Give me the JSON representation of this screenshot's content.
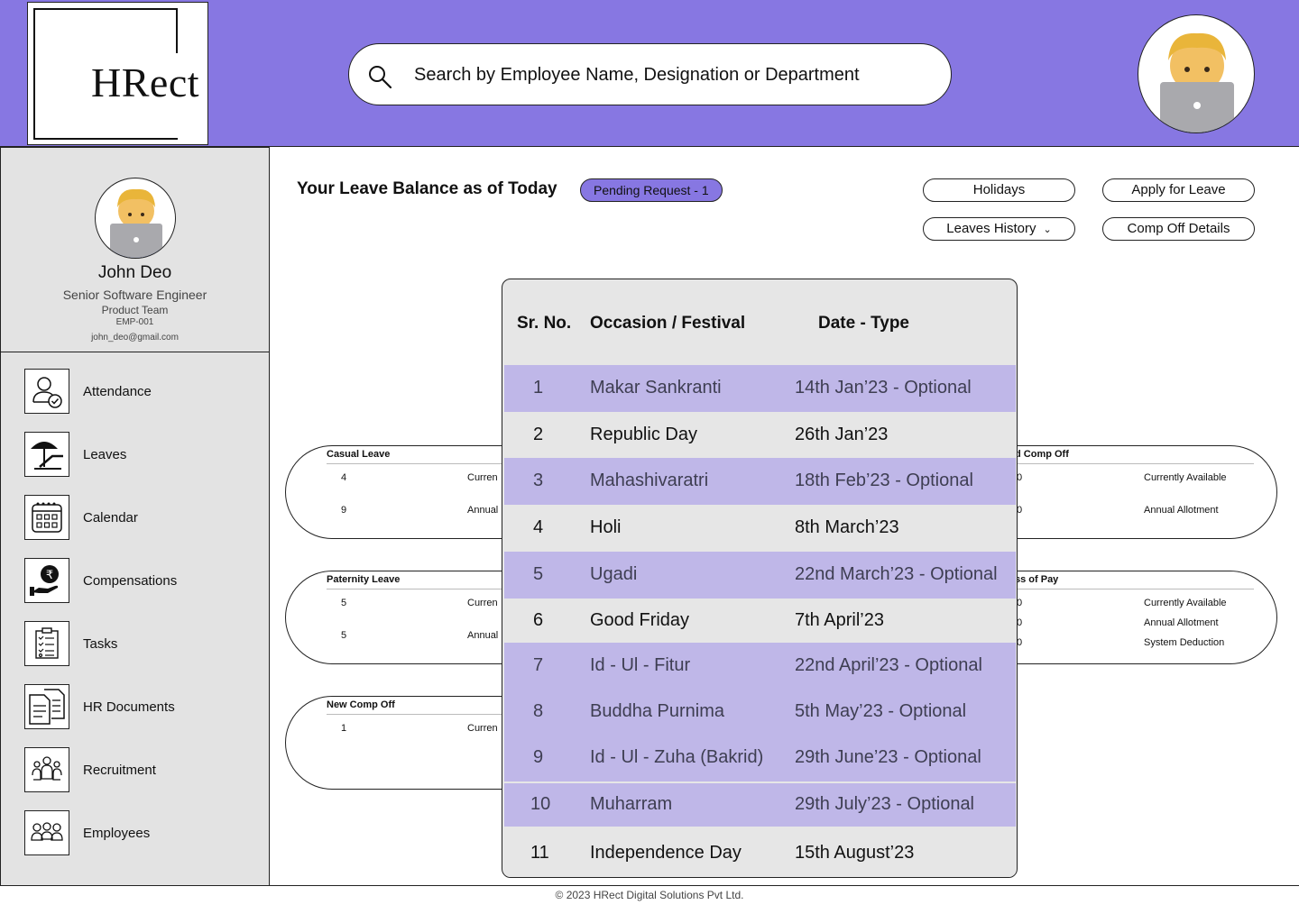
{
  "brand": {
    "logo_text": "HRect"
  },
  "search": {
    "placeholder": "Search by Employee Name, Designation or Department"
  },
  "profile": {
    "name": "John Deo",
    "role": "Senior Software Engineer",
    "team": "Product Team",
    "emp_id": "EMP-001",
    "email": "john_deo@gmail.com"
  },
  "nav": [
    {
      "label": "Attendance",
      "icon": "user-check-icon"
    },
    {
      "label": "Leaves",
      "icon": "beach-umbrella-icon"
    },
    {
      "label": "Calendar",
      "icon": "calendar-icon"
    },
    {
      "label": "Compensations",
      "icon": "rupee-hand-icon"
    },
    {
      "label": "Tasks",
      "icon": "clipboard-checklist-icon"
    },
    {
      "label": "HR Documents",
      "icon": "documents-icon"
    },
    {
      "label": "Recruitment",
      "icon": "people-group-icon"
    },
    {
      "label": "Employees",
      "icon": "employees-icon"
    }
  ],
  "main": {
    "title": "Your Leave Balance as of Today",
    "pending_badge": "Pending Request - 1",
    "buttons": {
      "holidays": "Holidays",
      "apply": "Apply for Leave",
      "history": "Leaves History",
      "comp_off": "Comp Off Details"
    }
  },
  "cards": {
    "casual": {
      "title": "Casual Leave",
      "rows": [
        {
          "value": "4",
          "label": "Curren"
        },
        {
          "value": "9",
          "label": "Annual"
        }
      ]
    },
    "paternity": {
      "title": "Paternity Leave",
      "rows": [
        {
          "value": "5",
          "label": "Curren"
        },
        {
          "value": "5",
          "label": "Annual"
        }
      ]
    },
    "new_comp": {
      "title": "New Comp Off",
      "rows": [
        {
          "value": "1",
          "label": "Curren"
        }
      ]
    },
    "right_comp": {
      "title": "d Comp Off",
      "rows": [
        {
          "value": "0",
          "label": "Currently Available"
        },
        {
          "value": "0",
          "label": "Annual Allotment"
        }
      ]
    },
    "loss_pay": {
      "title": "ss of Pay",
      "rows": [
        {
          "value": "0",
          "label": "Currently Available"
        },
        {
          "value": "0",
          "label": "Annual Allotment"
        },
        {
          "value": "0",
          "label": "System Deduction"
        }
      ]
    }
  },
  "holidays_modal": {
    "headers": {
      "sr": "Sr. No.",
      "occasion": "Occasion / Festival",
      "date": "Date - Type"
    },
    "rows": [
      {
        "sr": "1",
        "occasion": "Makar Sankranti",
        "date": "14th Jan’23 - Optional",
        "optional": true
      },
      {
        "sr": "2",
        "occasion": "Republic Day",
        "date": "26th Jan’23",
        "optional": false
      },
      {
        "sr": "3",
        "occasion": "Mahashivaratri",
        "date": "18th Feb’23 - Optional",
        "optional": true
      },
      {
        "sr": "4",
        "occasion": "Holi",
        "date": "8th March’23",
        "optional": false
      },
      {
        "sr": "5",
        "occasion": "Ugadi",
        "date": "22nd March’23 - Optional",
        "optional": true
      },
      {
        "sr": "6",
        "occasion": "Good Friday",
        "date": "7th April’23",
        "optional": false
      },
      {
        "sr": "7",
        "occasion": "Id - Ul - Fitur",
        "date": "22nd April’23 - Optional",
        "optional": true
      },
      {
        "sr": "8",
        "occasion": "Buddha Purnima",
        "date": "5th May’23 - Optional",
        "optional": true
      },
      {
        "sr": "9",
        "occasion": "Id - Ul - Zuha (Bakrid)",
        "date": "29th June’23 - Optional",
        "optional": true
      },
      {
        "sr": "10",
        "occasion": "Muharram",
        "date": "29th July’23 - Optional",
        "optional": true
      },
      {
        "sr": "11",
        "occasion": "Independence Day",
        "date": "15th August’23",
        "optional": false
      }
    ]
  },
  "footer": {
    "text": "© 2023 HRect Digital Solutions Pvt Ltd."
  },
  "colors": {
    "accent": "#8777e2",
    "optional_row": "#bfb7e8",
    "panel": "#e3e3e3"
  }
}
